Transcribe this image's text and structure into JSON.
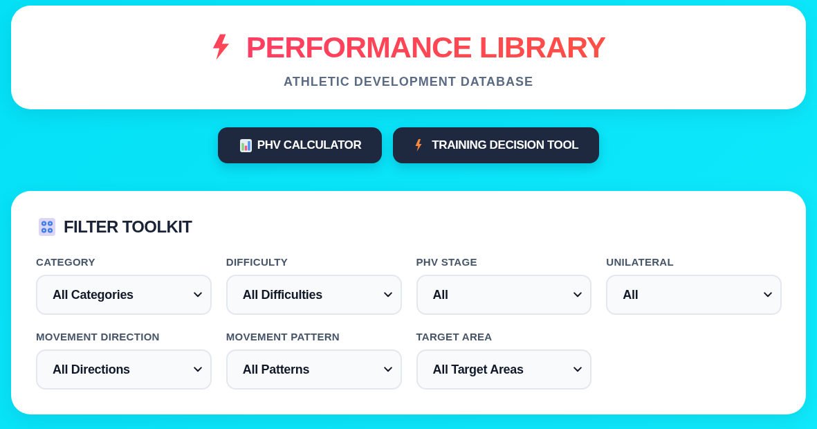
{
  "header": {
    "title": "PERFORMANCE LIBRARY",
    "subtitle": "ATHLETIC DEVELOPMENT DATABASE"
  },
  "tools": [
    {
      "label": "PHV CALCULATOR",
      "kind": "chart"
    },
    {
      "label": "TRAINING DECISION TOOL",
      "kind": "bolt"
    }
  ],
  "filter_panel": {
    "title": "FILTER TOOLKIT",
    "filters": [
      {
        "label": "CATEGORY",
        "value": "All Categories"
      },
      {
        "label": "DIFFICULTY",
        "value": "All Difficulties"
      },
      {
        "label": "PHV STAGE",
        "value": "All"
      },
      {
        "label": "UNILATERAL",
        "value": "All"
      },
      {
        "label": "MOVEMENT DIRECTION",
        "value": "All Directions"
      },
      {
        "label": "MOVEMENT PATTERN",
        "value": "All Patterns"
      },
      {
        "label": "TARGET AREA",
        "value": "All Target Areas"
      }
    ]
  }
}
